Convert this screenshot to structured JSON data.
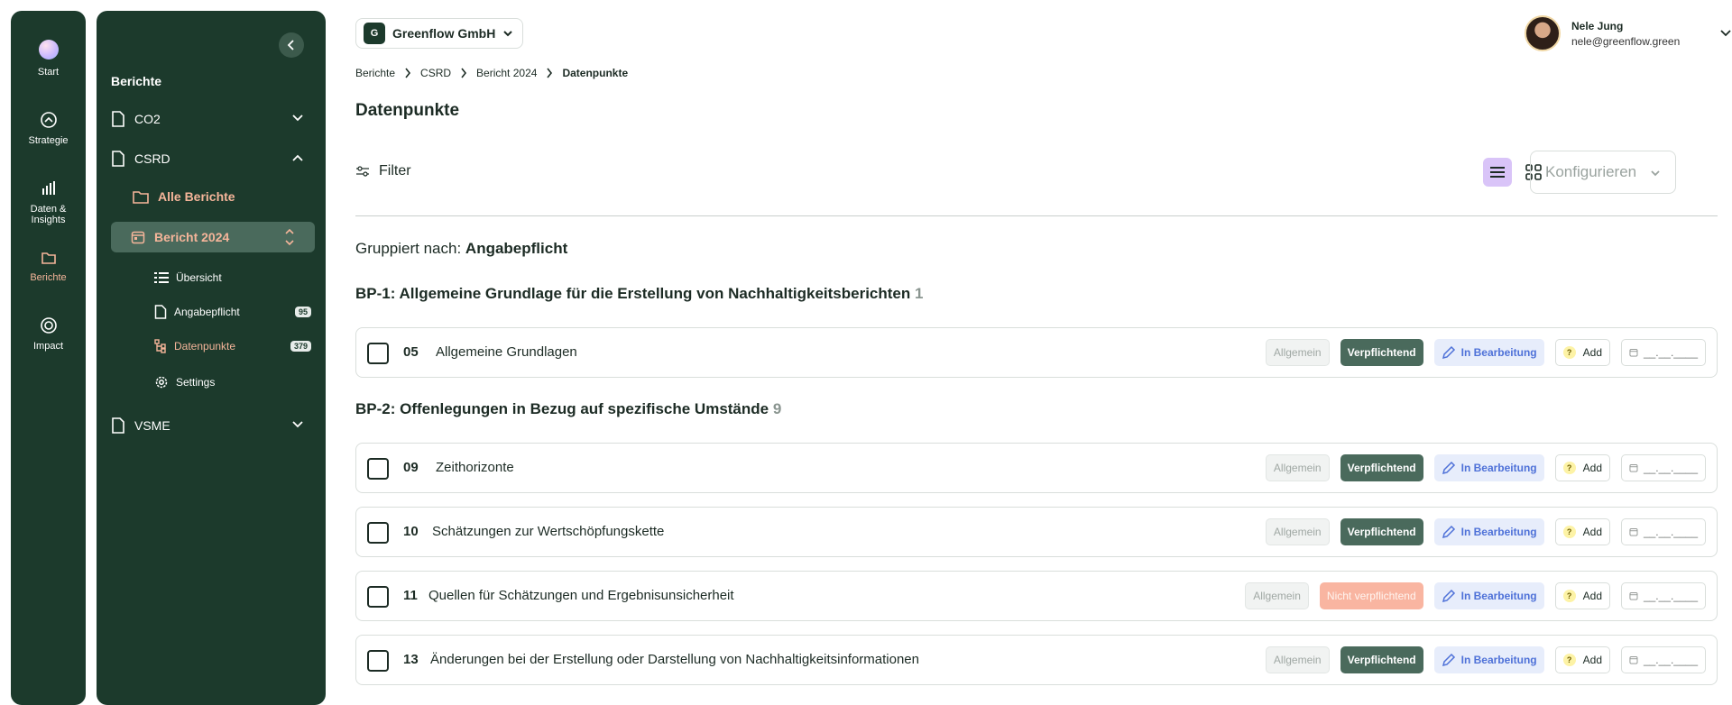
{
  "rail": {
    "items": [
      {
        "label": "Start",
        "icon": "start-orb-icon"
      },
      {
        "label": "Strategie",
        "icon": "compass-icon"
      },
      {
        "label": "Daten & Insights",
        "icon": "bar-chart-icon"
      },
      {
        "label": "Berichte",
        "icon": "folder-icon"
      },
      {
        "label": "Impact",
        "icon": "impact-icon"
      }
    ]
  },
  "sidebar": {
    "title": "Berichte",
    "reports": [
      {
        "label": "CO2",
        "expanded": false
      },
      {
        "label": "CSRD",
        "expanded": true
      },
      {
        "label": "VSME",
        "expanded": false
      }
    ],
    "all_reports": "Alle Berichte",
    "current_report": "Bericht 2024",
    "leaves": [
      {
        "label": "Übersicht",
        "count": "",
        "icon": "list-icon"
      },
      {
        "label": "Angabepflicht",
        "count": "95",
        "icon": "document-icon"
      },
      {
        "label": "Datenpunkte",
        "count": "379",
        "icon": "datapoints-icon"
      },
      {
        "label": "Settings",
        "count": "",
        "icon": "gear-icon"
      }
    ]
  },
  "header": {
    "org_initial": "G",
    "org_name": "Greenflow GmbH",
    "user_name": "Nele Jung",
    "user_email": "nele@greenflow.green"
  },
  "breadcrumb": [
    "Berichte",
    "CSRD",
    "Bericht 2024",
    "Datenpunkte"
  ],
  "page_title": "Datenpunkte",
  "toolbar": {
    "filter_label": "Filter",
    "configure_label": "Konfigurieren"
  },
  "grouping": {
    "prefix": "Gruppiert nach:",
    "value": "Angabepflicht"
  },
  "groups": [
    {
      "title": "BP-1: Allgemeine Grundlage für die Erstellung von Nachhaltigkeitsberichten",
      "count": "1",
      "rows": [
        {
          "num": "05",
          "title": "Allgemeine Grundlagen",
          "category": "Allgemein",
          "obligation": "Verpflichtend",
          "required": true,
          "status": "In Bearbeitung",
          "add": "Add",
          "date": "__.__.____"
        }
      ]
    },
    {
      "title": "BP-2: Offenlegungen in Bezug auf spezifische Umstände",
      "count": "9",
      "rows": [
        {
          "num": "09",
          "title": "Zeithorizonte",
          "category": "Allgemein",
          "obligation": "Verpflichtend",
          "required": true,
          "status": "In Bearbeitung",
          "add": "Add",
          "date": "__.__.____"
        },
        {
          "num": "10",
          "title": "Schätzungen zur Wertschöpfungskette",
          "category": "Allgemein",
          "obligation": "Verpflichtend",
          "required": true,
          "status": "In Bearbeitung",
          "add": "Add",
          "date": "__.__.____"
        },
        {
          "num": "11",
          "title": "Quellen für Schätzungen und Ergebnisunsicherheit",
          "category": "Allgemein",
          "obligation": "Nicht verpflichtend",
          "required": false,
          "status": "In Bearbeitung",
          "add": "Add",
          "date": "__.__.____"
        },
        {
          "num": "13",
          "title": "Änderungen bei der Erstellung oder Darstellung von Nachhaltigkeitsinformationen",
          "category": "Allgemein",
          "obligation": "Verpflichtend",
          "required": true,
          "status": "In Bearbeitung",
          "add": "Add",
          "date": "__.__.____"
        }
      ]
    }
  ],
  "colors": {
    "sidebar_bg": "#1c3a2c",
    "accent_orange": "#f5b59a",
    "required_tag": "#4a6a5c",
    "optional_tag": "#f9b5a1",
    "status_blue": "#4e71d8",
    "active_view": "#d9c4f8"
  }
}
